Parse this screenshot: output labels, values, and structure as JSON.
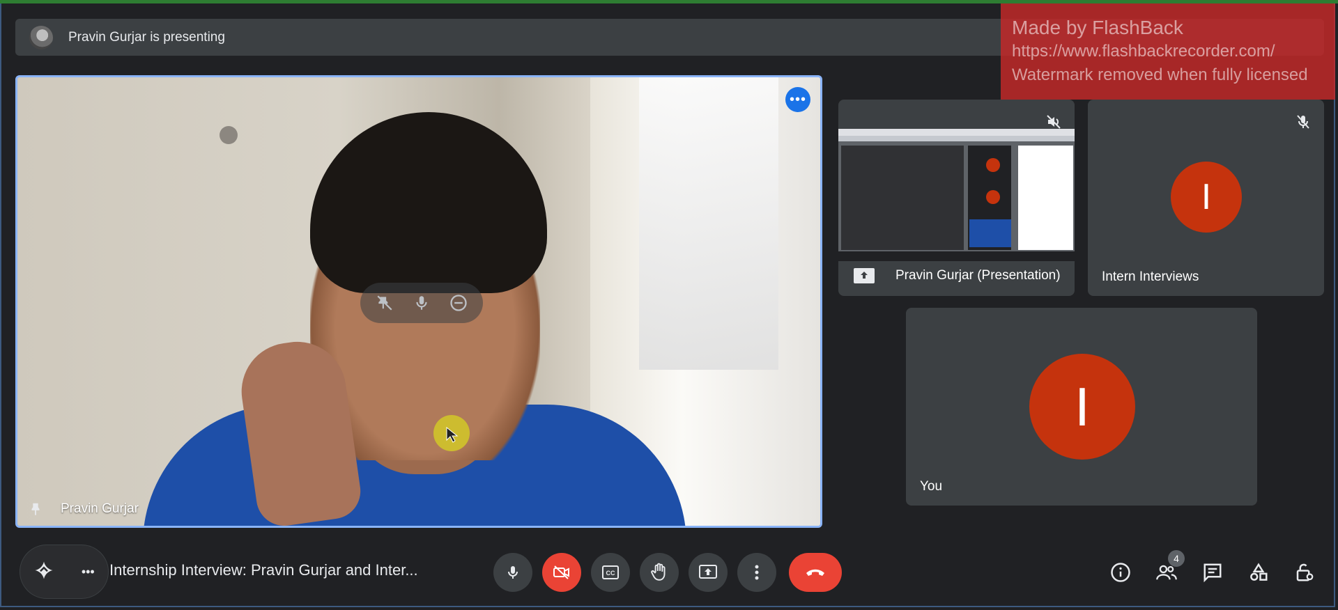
{
  "presenting_bar": {
    "text": "Pravin Gurjar is presenting"
  },
  "watermark": {
    "title": "Made by FlashBack",
    "url": "https://www.flashbackrecorder.com/",
    "note": "Watermark removed when fully licensed"
  },
  "main_tile": {
    "name": "Pravin Gurjar",
    "more_icon": "more-horizontal-icon"
  },
  "tiles": {
    "presentation": {
      "name": "Pravin Gurjar (Presentation)",
      "status_icon": "volume-off-icon"
    },
    "intern": {
      "name": "Intern Interviews",
      "avatar_letter": "I",
      "status_icon": "mic-off-icon"
    },
    "you": {
      "name": "You",
      "avatar_letter": "I"
    }
  },
  "bottom_bar": {
    "meeting_title": "Internship Interview: Pravin Gurjar and Inter...",
    "participants_count": "4",
    "controls": [
      "mic-icon",
      "camera-off-icon",
      "captions-icon",
      "raise-hand-icon",
      "present-icon",
      "more-options-icon",
      "leave-call-icon"
    ],
    "right_icons": [
      "info-icon",
      "people-icon",
      "chat-icon",
      "activities-icon",
      "host-controls-icon"
    ]
  },
  "colors": {
    "background": "#202124",
    "tile": "#3c4043",
    "accent_blue": "#8ab4f8",
    "red": "#ea4335",
    "avatar": "#c5330d"
  }
}
